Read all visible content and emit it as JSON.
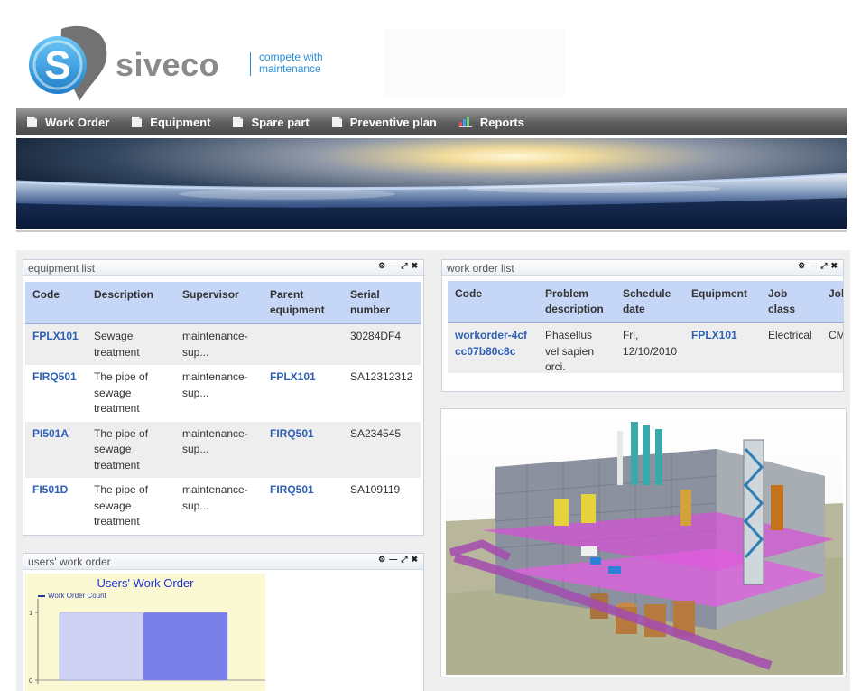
{
  "brand": {
    "name": "siveco",
    "tagline_line1": "compete with",
    "tagline_line2": "maintenance",
    "logo_letter": "S"
  },
  "nav": {
    "items": [
      {
        "label": "Work Order",
        "icon": "document-icon"
      },
      {
        "label": "Equipment",
        "icon": "document-icon"
      },
      {
        "label": "Spare part",
        "icon": "document-icon"
      },
      {
        "label": "Preventive plan",
        "icon": "document-icon"
      },
      {
        "label": "Reports",
        "icon": "reports-icon"
      }
    ]
  },
  "equipment_list": {
    "title": "equipment list",
    "headers": [
      "Code",
      "Description",
      "Supervisor",
      "Parent equipment",
      "Serial number"
    ],
    "rows": [
      {
        "code": "FPLX101",
        "description": "Sewage treatment",
        "supervisor": "maintenance-sup...",
        "parent": "",
        "serial": "30284DF4"
      },
      {
        "code": "FIRQ501",
        "description": "The pipe of sewage treatment",
        "supervisor": "maintenance-sup...",
        "parent": "FPLX101",
        "serial": "SA12312312"
      },
      {
        "code": "PI501A",
        "description": "The pipe of sewage treatment",
        "supervisor": "maintenance-sup...",
        "parent": "FIRQ501",
        "serial": "SA234545"
      },
      {
        "code": "FI501D",
        "description": "The pipe of sewage treatment",
        "supervisor": "maintenance-sup...",
        "parent": "FIRQ501",
        "serial": "SA109119"
      }
    ]
  },
  "work_order_list": {
    "title": "work order list",
    "headers": [
      "Code",
      "Problem description",
      "Schedule date",
      "Equipment",
      "Job class",
      "Job type"
    ],
    "rows": [
      {
        "code": "workorder-4cfcc07b80c8c",
        "problem": "Phasellus vel sapien orci.",
        "date": "Fri, 12/10/2010",
        "equipment": "FPLX101",
        "job_class": "Electrical",
        "job_type": "CM"
      }
    ]
  },
  "users_work_order": {
    "title": "users' work order"
  },
  "chart_data": {
    "type": "bar",
    "title": "Users' Work Order",
    "legend": "Work Order Count",
    "legend_position": "top-left",
    "categories": [
      "",
      ""
    ],
    "values": [
      1,
      1
    ],
    "yticks": [
      "0",
      "1"
    ],
    "ylim": [
      0,
      1.2
    ],
    "colors": [
      "#cfd2f2",
      "#7b7fe8"
    ]
  },
  "colors": {
    "accent": "#2a8fd6",
    "link": "#2d5fb3",
    "table_header": "#c6d6f7",
    "nav_bg": "#5d5d5d"
  }
}
